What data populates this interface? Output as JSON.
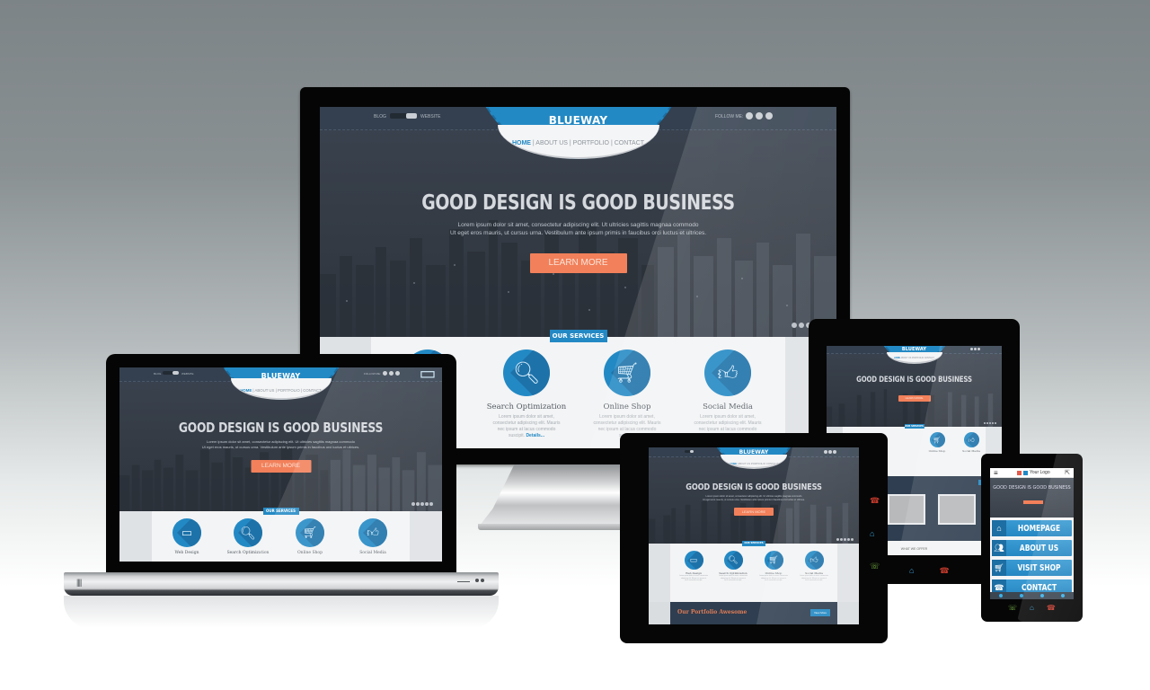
{
  "scene": "Responsive web design mockup across devices",
  "site": {
    "brand": "BLUEWAY",
    "topbar": {
      "toggle_left": "BLOG",
      "toggle_right": "WEBSITE",
      "follow_label": "FOLLOW ME:"
    },
    "nav": [
      {
        "label": "HOME",
        "active": true
      },
      {
        "label": "ABOUT US",
        "active": false
      },
      {
        "label": "PORTFOLIO",
        "active": false
      },
      {
        "label": "CONTACT",
        "active": false
      }
    ],
    "nav_separator": "|",
    "hero": {
      "headline": "GOOD DESIGN IS GOOD BUSINESS",
      "text_line1": "Lorem ipsum dolor sit amet, consectetur adipiscing elit. Ut ultricies sagittis magnaa commodo",
      "text_line2": "Ut eget eros mauris, ut cursus urna. Vestibulum ante ipsum primis in faucibus orci luctus et ultrices.",
      "cta": "LEARN MORE",
      "slider_dots": 5,
      "slider_active": 4
    },
    "services": {
      "label": "OUR SERVICES",
      "items": [
        {
          "title": "Web Design",
          "icon": "laptop-icon",
          "desc": "Lorem ipsum dolor sit amet, consectetur adipiscing elit. Mauris nec ipsum at lacus commodo suscipit.",
          "link": "Details..."
        },
        {
          "title": "Search Optimization",
          "icon": "magnifier-icon",
          "desc": "Lorem ipsum dolor sit amet, consectetur adipiscing elit. Mauris nec ipsum at lacus commodo suscipit.",
          "link": "Details..."
        },
        {
          "title": "Online Shop",
          "icon": "shopping-cart-icon",
          "desc": "Lorem ipsum dolor sit amet, consectetur adipiscing elit. Mauris nec ipsum at lacus commodo suscipit.",
          "link": "Details..."
        },
        {
          "title": "Social Media",
          "icon": "thumbs-up-icon",
          "desc": "Lorem ipsum dolor sit amet, consectetur adipiscing elit. Mauris nec ipsum at lacus commodo suscipit.",
          "link": "Details..."
        }
      ]
    },
    "portfolio": {
      "title": "Our Portfolio Awesome",
      "button": "View More"
    },
    "what_we_offer": "WHAT WE OFFER"
  },
  "phone_site": {
    "logo": "Your Logo",
    "headline": "GOOD DESIGN IS GOOD BUSINESS",
    "menu": [
      {
        "label": "HOMEPAGE",
        "icon": "home-icon"
      },
      {
        "label": "ABOUT US",
        "icon": "users-icon"
      },
      {
        "label": "VISIT SHOP",
        "icon": "shopping-cart-icon"
      },
      {
        "label": "CONTACT",
        "icon": "phone-icon"
      }
    ]
  },
  "colors": {
    "brand_blue": "#2389c4",
    "cta_orange": "#f2805a",
    "hero_dark": "#363d47",
    "portfolio_title": "#e07c56"
  }
}
